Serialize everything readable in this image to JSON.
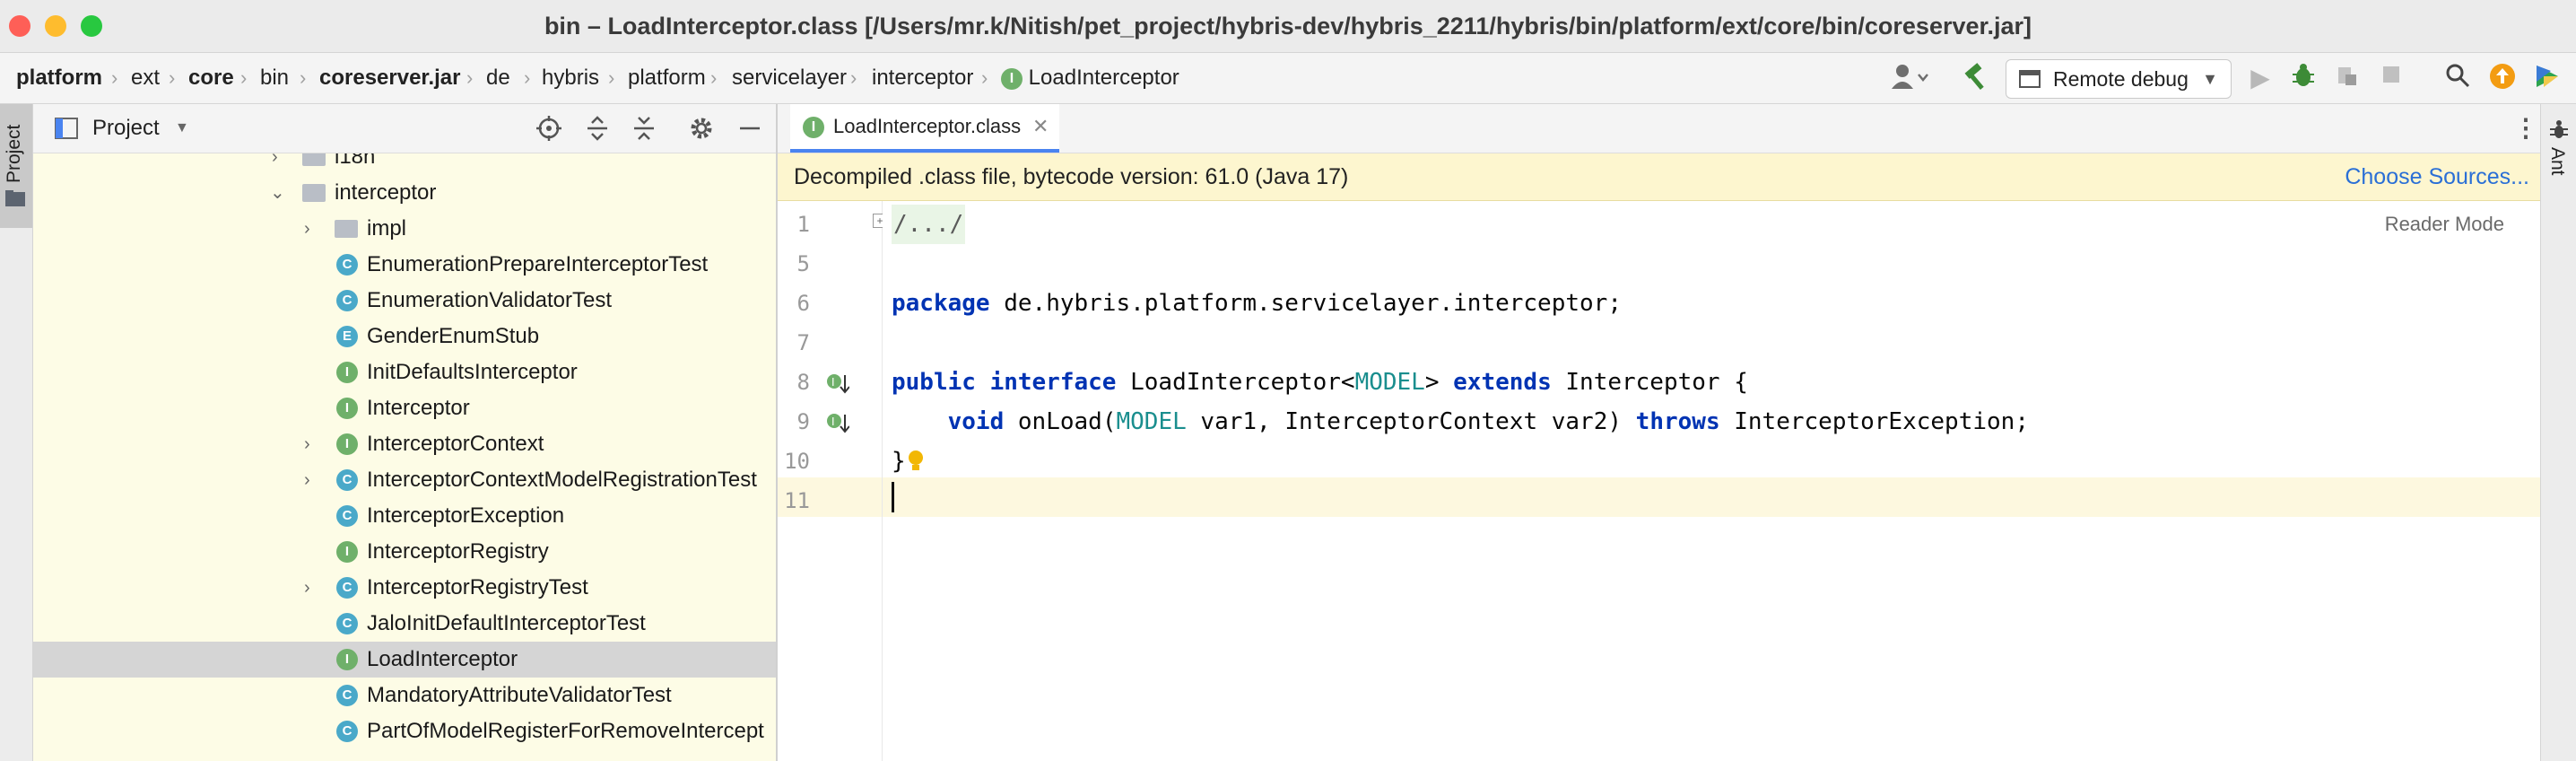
{
  "window": {
    "title": "bin – LoadInterceptor.class [/Users/mr.k/Nitish/pet_project/hybris-dev/hybris_2211/hybris/bin/platform/ext/core/bin/coreserver.jar]",
    "traffic_lights": {
      "close": "#fe5f57",
      "minimize": "#febc2e",
      "maximize": "#28c840"
    }
  },
  "breadcrumb": {
    "items": [
      "platform",
      "ext",
      "core",
      "bin",
      "coreserver.jar",
      "de",
      "hybris",
      "platform",
      "servicelayer",
      "interceptor",
      "LoadInterceptor"
    ],
    "badge": "I"
  },
  "toolbar": {
    "run_config": "Remote debug",
    "icons": [
      "user-icon",
      "build-hammer-icon",
      "run-icon",
      "debug-icon",
      "attach-icon",
      "stop-icon",
      "search-icon",
      "update-icon",
      "plugin-icon"
    ]
  },
  "left_strip": {
    "project_tab": "Project"
  },
  "project_panel": {
    "title": "Project",
    "tree": [
      {
        "label": "i18n",
        "kind": "folder",
        "depth": 1,
        "arrow": "›"
      },
      {
        "label": "interceptor",
        "kind": "folder",
        "depth": 1,
        "arrow": "⌄"
      },
      {
        "label": "impl",
        "kind": "folder",
        "depth": 2,
        "arrow": "›"
      },
      {
        "label": "EnumerationPrepareInterceptorTest",
        "kind": "C",
        "depth": 2,
        "arrow": ""
      },
      {
        "label": "EnumerationValidatorTest",
        "kind": "C",
        "depth": 2,
        "arrow": ""
      },
      {
        "label": "GenderEnumStub",
        "kind": "E",
        "depth": 2,
        "arrow": ""
      },
      {
        "label": "InitDefaultsInterceptor",
        "kind": "I",
        "depth": 2,
        "arrow": ""
      },
      {
        "label": "Interceptor",
        "kind": "I",
        "depth": 2,
        "arrow": ""
      },
      {
        "label": "InterceptorContext",
        "kind": "I",
        "depth": 2,
        "arrow": "›"
      },
      {
        "label": "InterceptorContextModelRegistrationTest",
        "kind": "C",
        "depth": 2,
        "arrow": "›"
      },
      {
        "label": "InterceptorException",
        "kind": "C",
        "depth": 2,
        "arrow": ""
      },
      {
        "label": "InterceptorRegistry",
        "kind": "I",
        "depth": 2,
        "arrow": ""
      },
      {
        "label": "InterceptorRegistryTest",
        "kind": "C",
        "depth": 2,
        "arrow": "›"
      },
      {
        "label": "JaloInitDefaultInterceptorTest",
        "kind": "C",
        "depth": 2,
        "arrow": ""
      },
      {
        "label": "LoadInterceptor",
        "kind": "I",
        "depth": 2,
        "arrow": "",
        "selected": true
      },
      {
        "label": "MandatoryAttributeValidatorTest",
        "kind": "C",
        "depth": 2,
        "arrow": ""
      },
      {
        "label": "PartOfModelRegisterForRemoveIntercept",
        "kind": "C",
        "depth": 2,
        "arrow": ""
      }
    ]
  },
  "editor": {
    "tab_label": "LoadInterceptor.class",
    "tab_badge": "I",
    "banner_text": "Decompiled .class file, bytecode version: 61.0 (Java 17)",
    "banner_link": "Choose Sources...",
    "reader_mode": "Reader Mode",
    "lines": [
      {
        "num": "1",
        "text": "/.../"
      },
      {
        "num": "5",
        "text": ""
      },
      {
        "num": "6",
        "text": "package de.hybris.platform.servicelayer.interceptor;"
      },
      {
        "num": "7",
        "text": ""
      },
      {
        "num": "8",
        "text": "public interface LoadInterceptor<MODEL> extends Interceptor {"
      },
      {
        "num": "9",
        "text": "    void onLoad(MODEL var1, InterceptorContext var2) throws InterceptorException;"
      },
      {
        "num": "10",
        "text": "}"
      },
      {
        "num": "11",
        "text": ""
      }
    ]
  },
  "right_strip": {
    "ant_tab": "Ant"
  }
}
